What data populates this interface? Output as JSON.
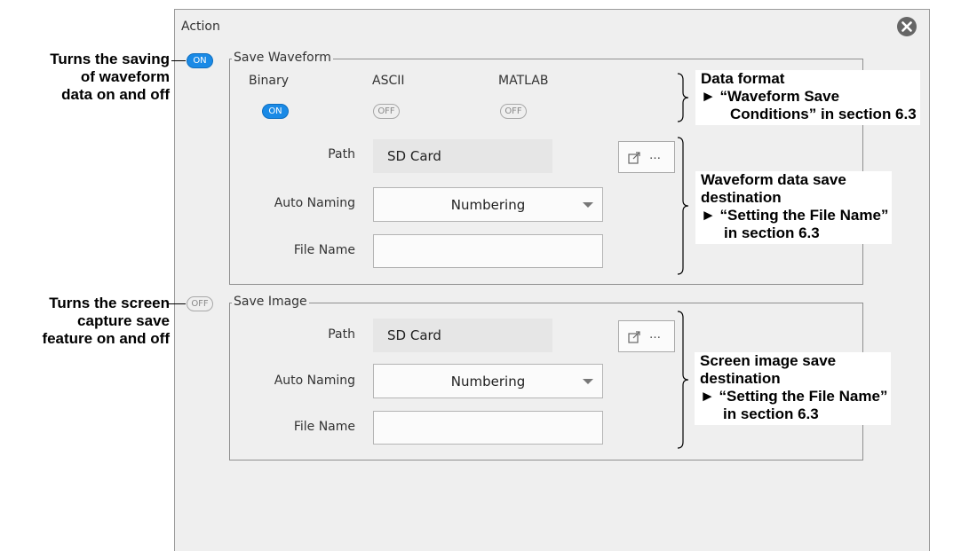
{
  "window": {
    "title": "Action",
    "close_icon": "close-circle-icon"
  },
  "save_waveform": {
    "toggle": "ON",
    "legend": "Save Waveform",
    "formats": [
      {
        "label": "Binary",
        "state": "ON"
      },
      {
        "label": "ASCII",
        "state": "OFF"
      },
      {
        "label": "MATLAB",
        "state": "OFF"
      }
    ],
    "path_label": "Path",
    "path_value": "SD Card",
    "browse_icon": "open-folder-icon",
    "browse_text": "…",
    "auto_naming_label": "Auto Naming",
    "auto_naming_value": "Numbering",
    "file_name_label": "File Name",
    "file_name_value": ""
  },
  "save_image": {
    "toggle": "OFF",
    "legend": "Save Image",
    "path_label": "Path",
    "path_value": "SD Card",
    "browse_icon": "open-folder-icon",
    "browse_text": "…",
    "auto_naming_label": "Auto Naming",
    "auto_naming_value": "Numbering",
    "file_name_label": "File Name",
    "file_name_value": ""
  },
  "annotations": {
    "waveform_toggle": [
      "Turns the saving",
      "of waveform",
      "data on and off"
    ],
    "image_toggle": [
      "Turns the screen",
      "capture save",
      "feature on and off"
    ],
    "data_format": [
      "Data format",
      "► “Waveform Save",
      "Conditions” in section 6.3"
    ],
    "waveform_dest": [
      "Waveform data save",
      "destination",
      "► “Setting the File Name”",
      "in section 6.3"
    ],
    "image_dest": [
      "Screen image save",
      "destination",
      "► “Setting the File Name”",
      "in section 6.3"
    ]
  },
  "colors": {
    "on": "#1a8ae6",
    "panel": "#efefef",
    "border": "#8f8f8f"
  }
}
